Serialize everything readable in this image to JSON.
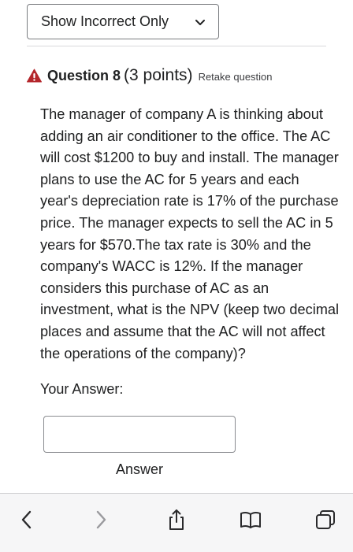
{
  "filter": {
    "selected": "Show Incorrect Only"
  },
  "question": {
    "title": "Question 8",
    "points": "(3 points)",
    "retake": "Retake question",
    "text": "The manager of company A is thinking about adding an air conditioner to the office. The AC will cost $1200 to buy and install. The manager plans to use the AC for 5 years and each year's depreciation rate is 17% of the purchase price. The manager expects to sell the AC in 5 years for $570.The tax rate is 30% and the company's WACC is 12%. If the manager considers this purchase of AC as an investment, what is the NPV (keep two decimal places and assume that the AC will not affect the operations of the company)?"
  },
  "answer": {
    "prompt": "Your Answer:",
    "value": "",
    "field_label": "Answer"
  },
  "colors": {
    "warning": "#b4262b",
    "toolbar_icon": "#2a2a2c",
    "toolbar_icon_disabled": "#9a9a9e",
    "toolbar_bg": "#f6f6f7"
  },
  "toolbar": {
    "icons": [
      "back-icon",
      "forward-icon",
      "share-icon",
      "bookmarks-icon",
      "tabs-icon"
    ]
  }
}
